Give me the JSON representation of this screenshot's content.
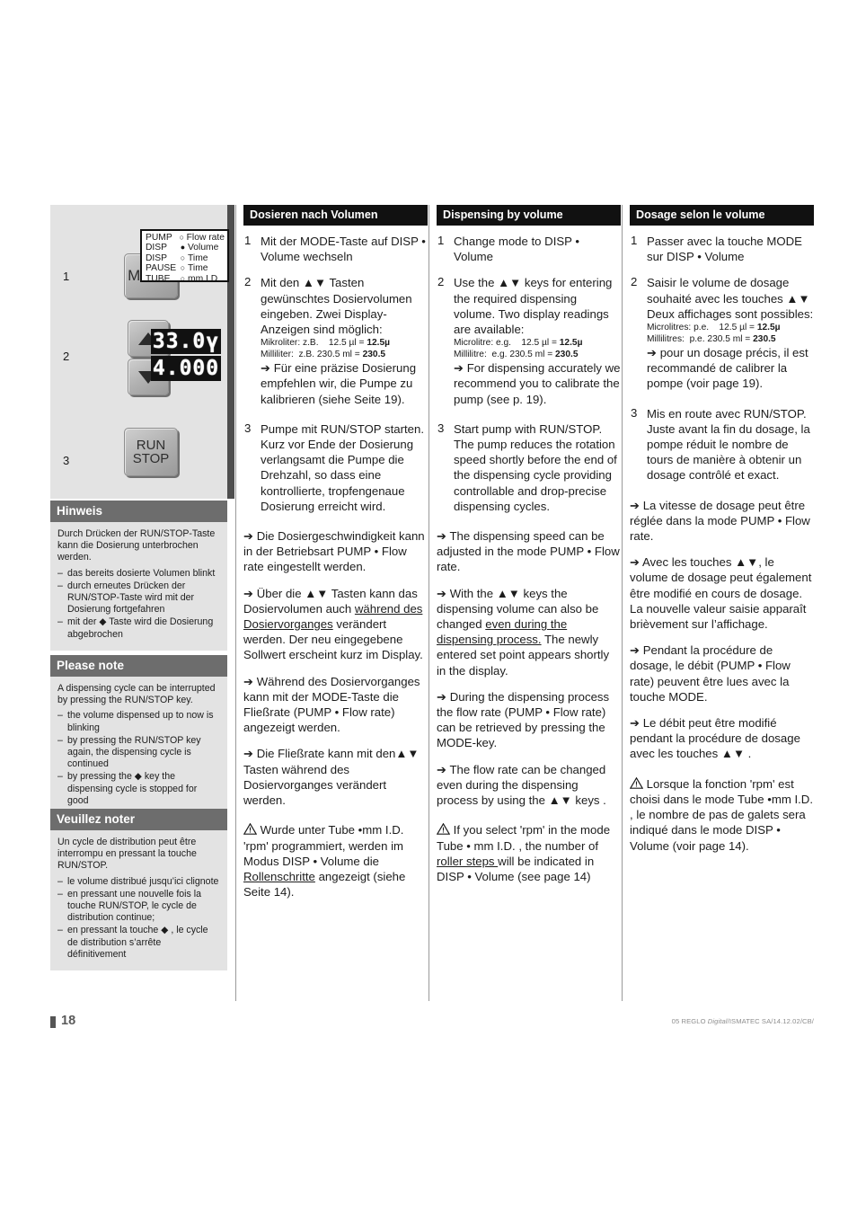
{
  "illustration": {
    "mode_button_label": "MODE",
    "run_button_line1": "RUN",
    "run_button_line2": "STOP",
    "step_labels": [
      "1",
      "2",
      "3"
    ],
    "mode_panel": [
      {
        "mode": "PUMP",
        "dot": "○",
        "param": "Flow rate"
      },
      {
        "mode": "DISP",
        "dot": "●",
        "param": "Volume"
      },
      {
        "mode": "DISP",
        "dot": "○",
        "param": "Time"
      },
      {
        "mode": "PAUSE",
        "dot": "○",
        "param": "Time"
      },
      {
        "mode": "TUBE",
        "dot": "○",
        "param": "mm I.D."
      }
    ],
    "lcd_upper": "33.0ү",
    "lcd_lower": "4.000"
  },
  "notes": [
    {
      "title": "Hinweis",
      "intro": "Durch Drücken der RUN/STOP-Taste kann die Dosierung unterbrochen werden.",
      "bullets": [
        "das bereits dosierte Volumen blinkt",
        "durch erneutes Drücken der RUN/STOP-Taste wird mit der Dosierung fortgefahren",
        "mit der ◆ Taste wird die Dosierung abgebrochen"
      ]
    },
    {
      "title": "Please note",
      "intro": "A dispensing cycle can be interrupted by pressing the RUN/STOP key.",
      "bullets": [
        "the volume dispensed up to now is blinking",
        "by pressing the RUN/STOP key again, the dispensing cycle is continued",
        "by pressing the ◆ key the dispensing cycle is stopped for good"
      ]
    },
    {
      "title": "Veuillez noter",
      "intro": "Un cycle de distribution peut être interrompu en pressant la touche RUN/STOP.",
      "bullets": [
        "le volume distribué jusqu’ici clignote",
        "en pressant une nouvelle fois la touche RUN/STOP, le cycle de distribution continue;",
        "en pressant la touche ◆ , le cycle de distribution s’arrête définitivement"
      ]
    }
  ],
  "de": {
    "heading": "Dosieren nach Volumen",
    "step1_num": "1",
    "step1_text": "Mit der MODE-Taste auf DISP • Volume wechseln",
    "step2_num": "2",
    "step2_text": "Mit den ▲▼ Tasten gewünschtes Dosiervolumen eingeben. Zwei Display-Anzeigen sind möglich:",
    "ex1_label": "Mikroliter:",
    "ex1_eg": "z.B.",
    "ex1_val": "12.5 µl =",
    "ex1_bold": "12.5µ",
    "ex2_label": "Milliliter:",
    "ex2_eg": "z.B.",
    "ex2_val": "230.5 ml =",
    "ex2_bold": "230.5",
    "step2_arrow": "➔ Für eine präzise Dosierung empfehlen wir, die Pumpe zu kalibrieren (siehe Seite 19).",
    "step3_num": "3",
    "step3_text": "Pumpe mit RUN/STOP starten. Kurz vor Ende der Dosierung verlangsamt die Pumpe die Drehzahl, so dass eine kontrollierte, tropfengenaue Dosierung erreicht wird.",
    "arrow1": "➔ Die Dosiergeschwindigkeit kann in der Betriebsart PUMP • Flow rate eingestellt werden.",
    "arrow2_a": "➔ Über die ▲▼ Tasten kann das Dosiervolumen auch ",
    "arrow2_u": "während des Dosiervorganges",
    "arrow2_b": " verändert werden. Der neu eingegebene Sollwert erscheint kurz im Display.",
    "arrow3": "➔ Während des Dosiervorganges kann mit der MODE-Taste die Fließrate (PUMP • Flow rate) angezeigt werden.",
    "arrow4": "➔ Die Fließrate kann mit den▲▼ Tasten während des Dosiervorganges verändert werden.",
    "warn_a": "Wurde unter Tube •mm I.D. 'rpm' programmiert, werden im Modus DISP • Volume  die ",
    "warn_u": "Rollenschritte",
    "warn_b": " angezeigt (siehe Seite 14)."
  },
  "en": {
    "heading": "Dispensing by volume",
    "step1_num": "1",
    "step1_text": "Change mode to DISP • Volume",
    "step2_num": "2",
    "step2_text": "Use the ▲▼ keys for entering the required dispensing volume. Two display readings are available:",
    "ex1_label": "Microlitre:",
    "ex1_eg": "e.g.",
    "ex1_val": "12.5 µl =",
    "ex1_bold": "12.5µ",
    "ex2_label": "Millilitre:",
    "ex2_eg": "e.g.",
    "ex2_val": "230.5 ml =",
    "ex2_bold": "230.5",
    "step2_arrow": "➔ For dispensing accurately we recommend you to calibrate the pump (see p. 19).",
    "step3_num": "3",
    "step3_text": "Start pump with RUN/STOP. The pump reduces the rotation speed shortly before the end of the dispensing cycle providing controllable and drop-precise dispensing cycles.",
    "arrow1": "➔ The dispensing speed can be adjusted in the mode PUMP • Flow rate.",
    "arrow2_a": "➔ With the ▲▼ keys the dispensing volume can  also be changed ",
    "arrow2_u": "even during the dispensing process.",
    "arrow2_b": " The newly entered set point appears shortly in the display.",
    "arrow3": "➔ During the dispensing process the flow rate (PUMP • Flow rate) can be retrieved by pressing the MODE-key.",
    "arrow4": "➔ The flow rate can be changed even during the dispensing process by using the ▲▼ keys .",
    "warn_a": "If you select 'rpm' in the mode Tube • mm I.D. , the number of ",
    "warn_u": "roller steps ",
    "warn_b": "will be indicated in DISP • Volume (see page 14)"
  },
  "fr": {
    "heading": "Dosage selon le volume",
    "step1_num": "1",
    "step1_text": "Passer avec la touche MODE sur DISP • Volume",
    "step2_num": "2",
    "step2_text": "Saisir le volume de dosage souhaité avec les touches ▲▼ Deux affichages sont possibles:",
    "ex1_label": "Microlitres:",
    "ex1_eg": "p.e.",
    "ex1_val": "12.5 µl =",
    "ex1_bold": "12.5µ",
    "ex2_label": "Millilitres:",
    "ex2_eg": "p.e.",
    "ex2_val": "230.5 ml =",
    "ex2_bold": "230.5",
    "step2_arrow": "➔ pour un dosage précis, il est recommandé de calibrer la pompe (voir page 19).",
    "step3_num": "3",
    "step3_text": "Mis en route avec RUN/STOP. Juste avant la fin du dosage, la pompe réduit le nombre de tours de manière à obtenir un dosage contrôlé et exact.",
    "arrow1": "➔  La vitesse de dosage peut être réglée dans la mode PUMP • Flow rate.",
    "arrow2_a": "➔ Avec les touches ▲▼, le volume de dosage peut également être modifié en cours de dosage. La nouvelle valeur saisie apparaît brièvement sur l’affichage.",
    "arrow2_u": "",
    "arrow2_b": "",
    "arrow3": "➔ Pendant la procédure de dosage, le débit (PUMP • Flow rate) peuvent être lues avec la touche MODE.",
    "arrow4": "➔ Le débit peut être modifié pendant la procédure de dosage avec les touches ▲▼ .",
    "warn_a": "Lorsque la fonction 'rpm' est choisi dans le mode Tube •mm I.D. , le nombre de pas de galets sera indiqué dans le mode DISP • Volume (voir page 14).",
    "warn_u": "",
    "warn_b": ""
  },
  "footer": {
    "page_number": "18",
    "doc_code_pre": "05 REGLO ",
    "doc_code_italic": "Digital",
    "doc_code_post": "/ISMATEC SA/14.12.02/CB/"
  },
  "colors": {
    "panel_grey": "#e3e3e3",
    "note_head_grey": "#6d6d6d",
    "col_head_black": "#111111",
    "lcd_black": "#111111",
    "rule_grey": "#9a9a9a"
  }
}
